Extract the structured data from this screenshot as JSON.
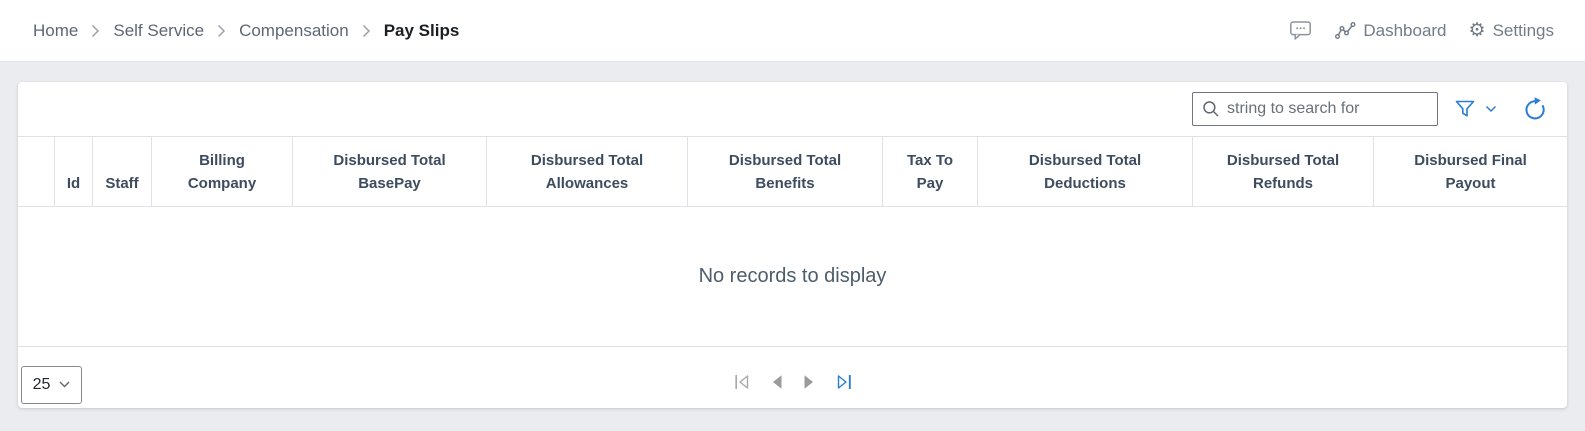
{
  "breadcrumb": {
    "items": [
      {
        "label": "Home"
      },
      {
        "label": "Self Service"
      },
      {
        "label": "Compensation"
      },
      {
        "label": "Pay Slips"
      }
    ],
    "separator_icon": "chevron-right-icon"
  },
  "topbar": {
    "chat_icon": "chat-bubble-icon",
    "dashboard_label": "Dashboard",
    "dashboard_icon": "line-chart-icon",
    "settings_label": "Settings",
    "settings_icon": "gear-icon",
    "gear_glyph": "⚙"
  },
  "toolbar": {
    "search": {
      "value": "",
      "placeholder": "string to search for",
      "icon": "search-icon"
    },
    "filter_icon": "funnel-icon",
    "filter_menu_icon": "chevron-down-icon",
    "refresh_icon": "refresh-icon"
  },
  "table": {
    "columns": [
      {
        "label": ""
      },
      {
        "label": "Id"
      },
      {
        "label": "Staff"
      },
      {
        "label": "Billing\nCompany"
      },
      {
        "label": "Disbursed Total\nBasePay"
      },
      {
        "label": "Disbursed Total\nAllowances"
      },
      {
        "label": "Disbursed Total\nBenefits"
      },
      {
        "label": "Tax To\nPay"
      },
      {
        "label": "Disbursed Total\nDeductions"
      },
      {
        "label": "Disbursed Total\nRefunds"
      },
      {
        "label": "Disbursed Final\nPayout"
      }
    ],
    "rows": [],
    "empty_message": "No records to display"
  },
  "pager": {
    "page_size": "25",
    "first_icon": "first-page-icon",
    "previous_icon": "previous-page-icon",
    "next_icon": "next-page-icon",
    "last_icon": "last-page-icon"
  },
  "colors": {
    "accent_blue": "#2a7cd4",
    "header_text": "#3d4c5e",
    "muted_text": "#717c87",
    "grid_border": "#dee2e6",
    "background": "#eaecef"
  }
}
